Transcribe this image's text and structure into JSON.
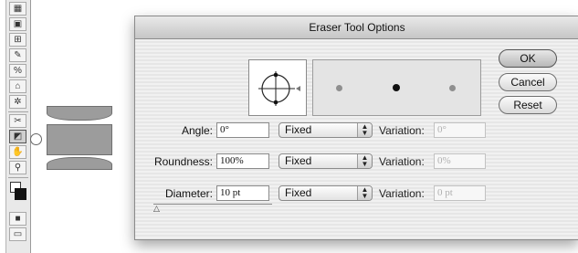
{
  "dialog": {
    "title": "Eraser Tool Options",
    "buttons": {
      "ok": "OK",
      "cancel": "Cancel",
      "reset": "Reset"
    }
  },
  "rows": [
    {
      "label": "Angle:",
      "value": "0°",
      "mode": "Fixed",
      "variation_label": "Variation:",
      "variation_value": "0°"
    },
    {
      "label": "Roundness:",
      "value": "100%",
      "mode": "Fixed",
      "variation_label": "Variation:",
      "variation_value": "0%"
    },
    {
      "label": "Diameter:",
      "value": "10 pt",
      "mode": "Fixed",
      "variation_label": "Variation:",
      "variation_value": "0 pt"
    }
  ],
  "toolbar": {
    "active_tool": "eraser-tool",
    "tools": [
      "graph-tool",
      "mesh-tool",
      "gradient-tool",
      "eyedropper-tool",
      "blend-tool",
      "live-paint-tool",
      "symbol-sprayer-tool",
      "slice-tool",
      "eraser-tool",
      "hand-tool",
      "zoom-tool",
      "fill-stroke-swatch",
      "screen-mode"
    ]
  },
  "colors": {
    "dialog_bg": "#ececec",
    "stroke_gray": "#9c9c9c",
    "default_button": "#b7b7b7"
  }
}
